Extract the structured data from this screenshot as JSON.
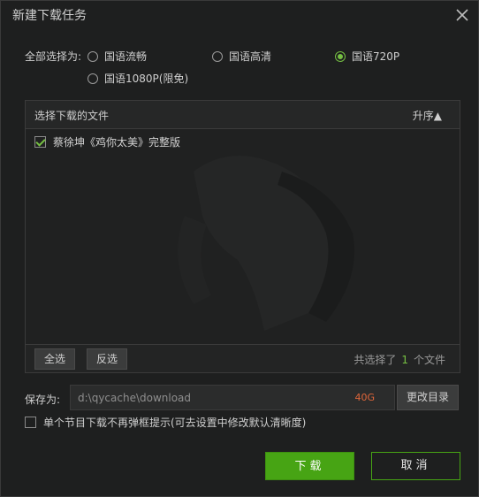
{
  "dialog": {
    "title": "新建下载任务"
  },
  "quality": {
    "label": "全部选择为:",
    "options": [
      {
        "label": "国语流畅",
        "selected": false
      },
      {
        "label": "国语高清",
        "selected": false
      },
      {
        "label": "国语720P",
        "selected": true
      },
      {
        "label": "国语1080P(限免)",
        "selected": false
      }
    ]
  },
  "filelist": {
    "header": "选择下载的文件",
    "sort_label": "升序▲",
    "items": [
      {
        "label": "蔡徐坤《鸡你太美》完整版",
        "checked": true
      }
    ],
    "select_all": "全选",
    "invert": "反选",
    "selected_prefix": "共选择了",
    "selected_count": "1",
    "selected_suffix": "个文件"
  },
  "save": {
    "label": "保存为:",
    "path": "d:\\qycache\\download",
    "free_space": "40G",
    "change_label": "更改目录"
  },
  "options": {
    "no_popup_label": "单个节目下载不再弹框提示(可去设置中修改默认清晰度)",
    "no_popup_checked": false
  },
  "actions": {
    "download": "下载",
    "cancel": "取消"
  },
  "colors": {
    "accent": "#47a414",
    "check": "#76c043",
    "space_warn": "#e0663a"
  }
}
